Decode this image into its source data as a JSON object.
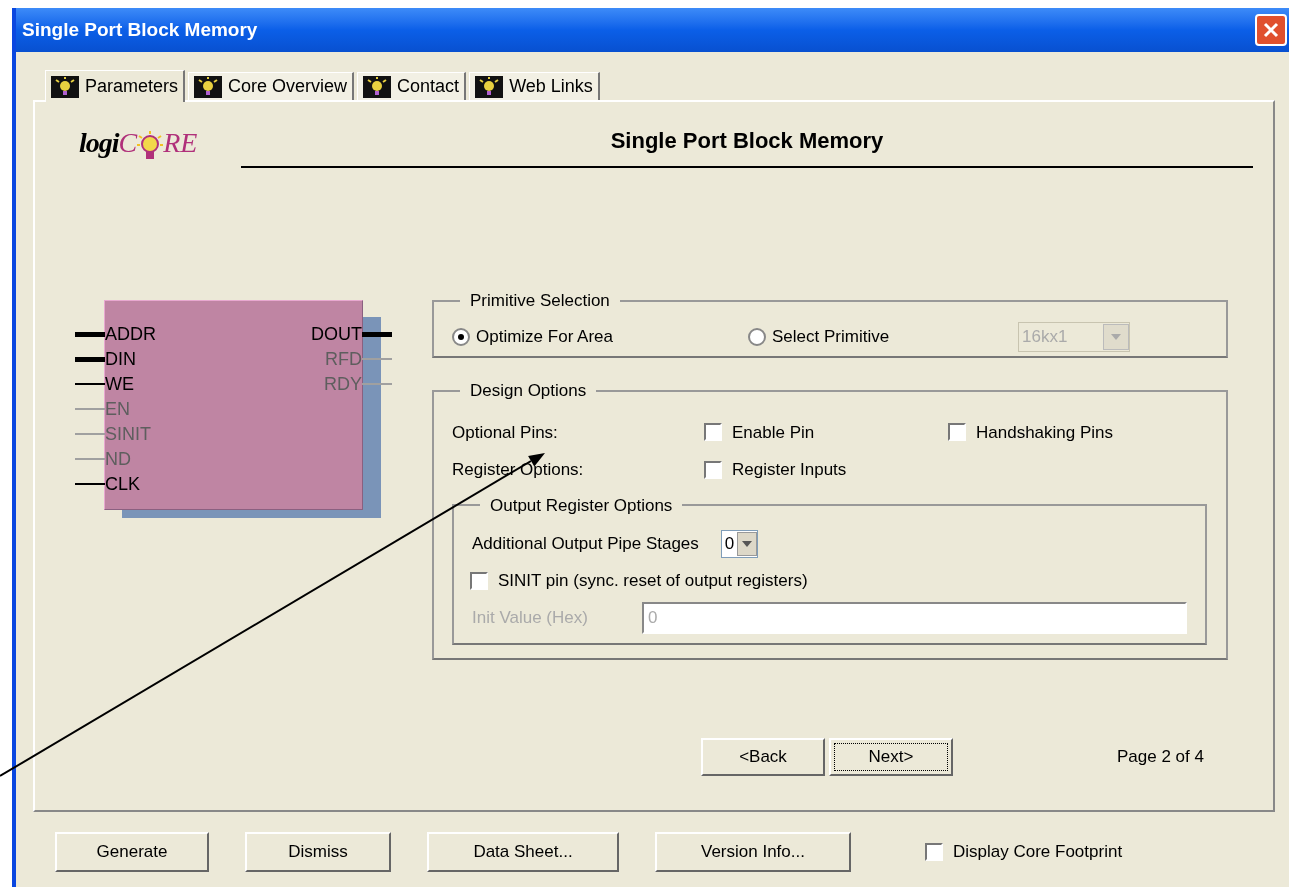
{
  "window": {
    "title": "Single Port Block Memory"
  },
  "tabs": [
    {
      "label": "Parameters",
      "selected": true
    },
    {
      "label": "Core Overview",
      "selected": false
    },
    {
      "label": "Contact",
      "selected": false
    },
    {
      "label": "Web Links",
      "selected": false
    }
  ],
  "logo": {
    "dark": "logi",
    "accent_1": "C",
    "accent_2": "RE"
  },
  "page_title": "Single Port Block Memory",
  "symbol": {
    "input_pins": [
      {
        "name": "ADDR",
        "enabled": true,
        "bus": true
      },
      {
        "name": "DIN",
        "enabled": true,
        "bus": true
      },
      {
        "name": "WE",
        "enabled": true,
        "bus": false
      },
      {
        "name": "EN",
        "enabled": false,
        "bus": false
      },
      {
        "name": "SINIT",
        "enabled": false,
        "bus": false
      },
      {
        "name": "ND",
        "enabled": false,
        "bus": false
      },
      {
        "name": "CLK",
        "enabled": true,
        "bus": false
      }
    ],
    "output_pins": [
      {
        "name": "DOUT",
        "enabled": true,
        "bus": true
      },
      {
        "name": "RFD",
        "enabled": false,
        "bus": false
      },
      {
        "name": "RDY",
        "enabled": false,
        "bus": false
      }
    ]
  },
  "primitive_selection": {
    "title": "Primitive Selection",
    "options": [
      {
        "label": "Optimize For Area",
        "selected": true
      },
      {
        "label": "Select Primitive",
        "selected": false
      }
    ],
    "dropdown": {
      "value": "16kx1",
      "disabled": true
    }
  },
  "design_options": {
    "title": "Design Options",
    "rows": [
      {
        "label": "Optional Pins:",
        "checkboxes": [
          {
            "label": "Enable Pin",
            "checked": false
          },
          {
            "label": "Handshaking Pins",
            "checked": false
          }
        ]
      },
      {
        "label": "Register Options:",
        "checkboxes": [
          {
            "label": "Register Inputs",
            "checked": false
          }
        ]
      }
    ],
    "output_register": {
      "title": "Output Register Options",
      "pipe_label": "Additional Output Pipe Stages",
      "pipe_value": "0",
      "sinit": {
        "label": "SINIT pin (sync. reset of output registers)",
        "checked": false
      },
      "init_label": "Init Value (Hex)",
      "init_value": "0",
      "init_disabled": true
    }
  },
  "nav": {
    "buttons": [
      {
        "label": "<Back",
        "focused": false
      },
      {
        "label": "Next>",
        "focused": true
      }
    ],
    "page": "Page 2 of 4"
  },
  "footer": {
    "buttons": [
      "Generate",
      "Dismiss",
      "Data Sheet...",
      "Version Info..."
    ],
    "checkbox": {
      "label": "Display Core Footprint",
      "checked": false
    }
  }
}
